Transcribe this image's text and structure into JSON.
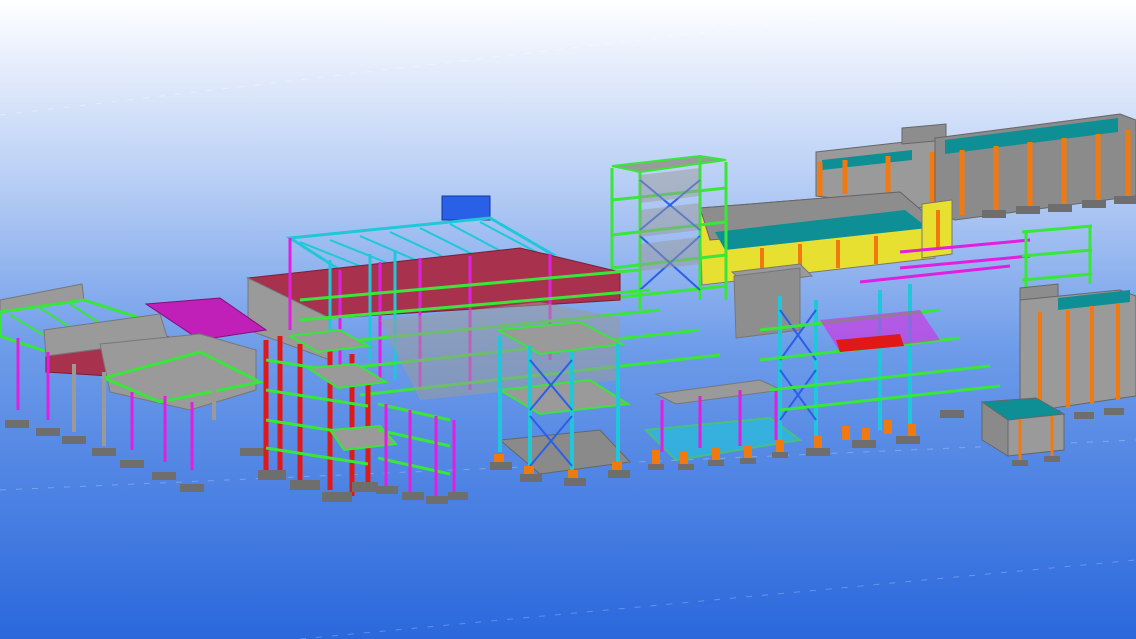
{
  "viewport": {
    "background_top": "#ffffff",
    "background_mid": "#8fb2ee",
    "background_bottom": "#2a68dc"
  },
  "palette": {
    "steel_green": "#39e63a",
    "steel_cyan": "#1fc8d8",
    "steel_magenta": "#e21ee0",
    "steel_red": "#e01818",
    "steel_blue": "#2a5fe8",
    "roof_maroon": "#a8324e",
    "concrete": "#9a9a9a",
    "concrete_dark": "#777777",
    "footing_orange": "#f07a10",
    "tank_teal": "#0e8f96",
    "wall_yellow": "#e8e030"
  },
  "model": {
    "view": "3d-perspective",
    "label_count": 0
  }
}
